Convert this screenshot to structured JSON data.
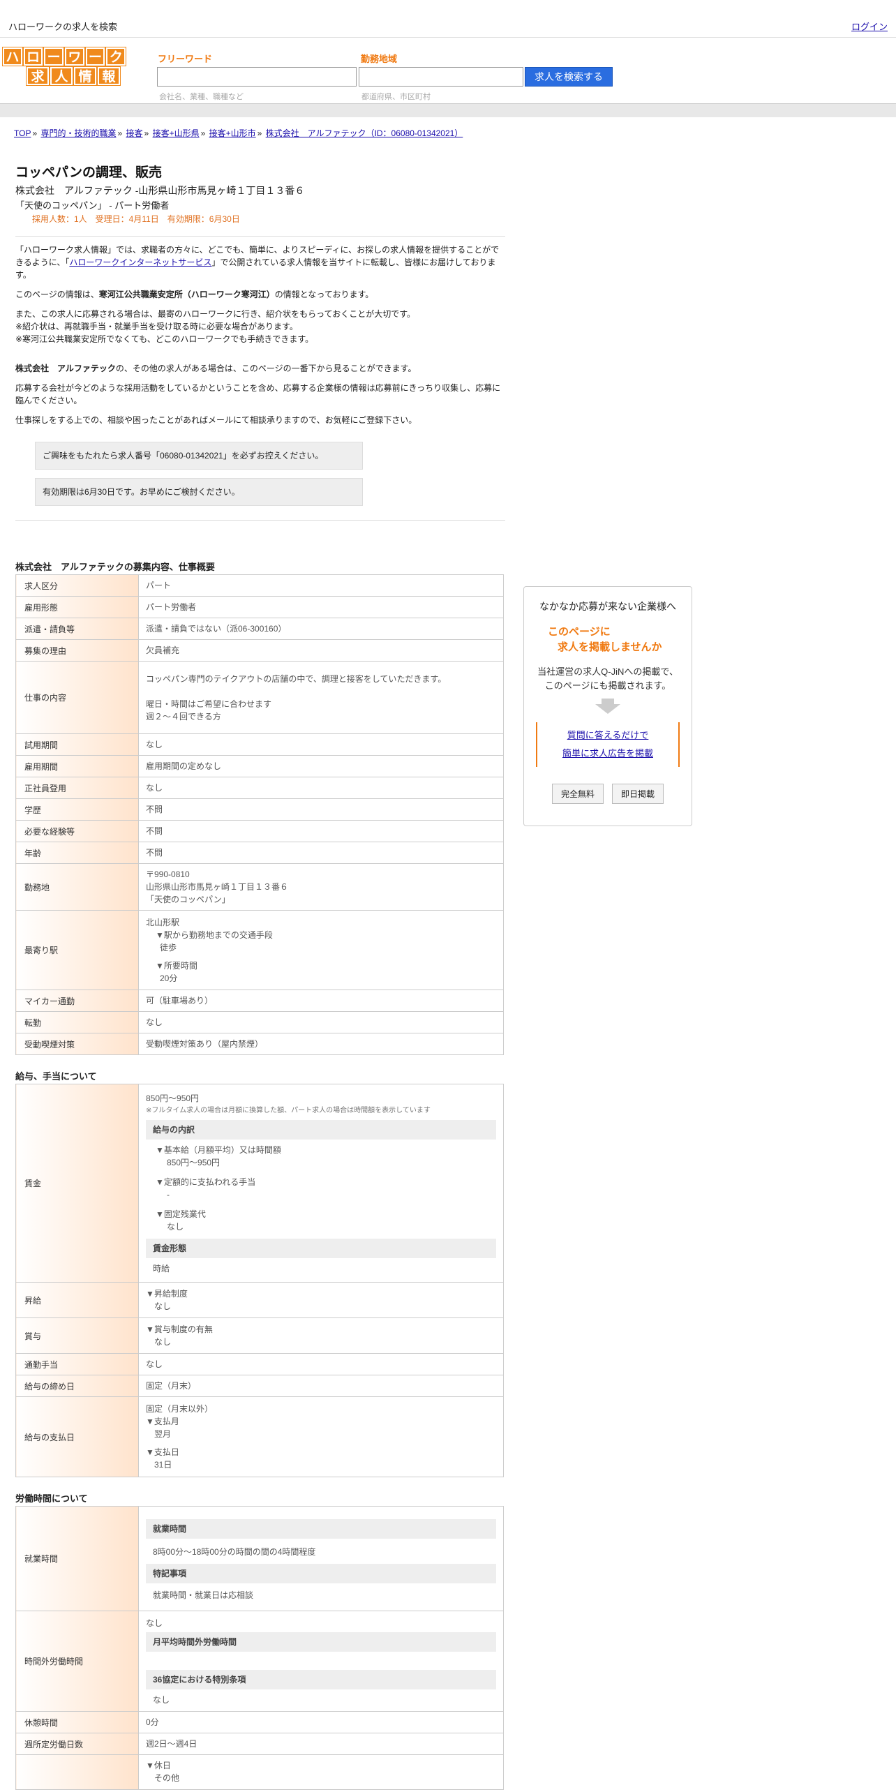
{
  "topbar": {
    "site_title": "ハローワークの求人を検索",
    "login": "ログイン"
  },
  "logo": {
    "row1": [
      "ハ",
      "ロ",
      "ー",
      "ワ",
      "ー",
      "ク"
    ],
    "row2": [
      "求",
      "人",
      "情",
      "報"
    ]
  },
  "search": {
    "keyword_label": "フリーワード",
    "keyword_placeholder": "会社名、業種、職種など",
    "area_label": "勤務地域",
    "area_placeholder": "都道府県、市区町村",
    "button": "求人を検索する"
  },
  "breadcrumb": [
    "TOP",
    "専門的・技術的職業",
    "接客",
    "接客+山形県",
    "接客+山形市",
    "株式会社　アルファテック（ID：06080-01342021）"
  ],
  "job": {
    "title": "コッペパンの調理、販売",
    "company_line": "株式会社　アルファテック -山形県山形市馬見ヶ崎１丁目１３番６",
    "sub_line": "「天使のコッペパン」 - パート労働者",
    "meta": "採用人数：1人　受理日：4月11日　有効期限：6月30日"
  },
  "intro": {
    "p1a": "「ハローワーク求人情報」では、求職者の方々に、どこでも、簡単に、よりスピーディに、お探しの求人情報を提供することができるように、「",
    "p1link": "ハローワークインターネットサービス",
    "p1b": "」で公開されている求人情報を当サイトに転載し、皆様にお届けしております。",
    "p2a": "このページの情報は、",
    "p2b": "寒河江公共職業安定所（ハローワーク寒河江）",
    "p2c": "の情報となっております。",
    "p3": "また、この求人に応募される場合は、最寄のハローワークに行き、紹介状をもらっておくことが大切です。",
    "p3b": "※紹介状は、再就職手当・就業手当を受け取る時に必要な場合があります。",
    "p3c": "※寒河江公共職業安定所でなくても、どこのハローワークでも手続きできます。",
    "p4a": "株式会社　アルファテック",
    "p4b": "の、その他の求人がある場合は、このページの一番下から見ることができます。",
    "p5": "応募する会社が今どのような採用活動をしているかということを含め、応募する企業様の情報は応募前にきっちり収集し、応募に臨んでください。",
    "p6": "仕事探しをする上での、相談や困ったことがあればメールにて相談承りますので、お気軽にご登録下さい。",
    "notice1": "ご興味をもたれたら求人番号「06080-01342021」を必ずお控えください。",
    "notice2": "有効期限は6月30日です。お早めにご検討ください。"
  },
  "overview": {
    "title": "株式会社　アルファテックの募集内容、仕事概要",
    "rows": {
      "kubun": [
        "求人区分",
        "パート"
      ],
      "keitai": [
        "雇用形態",
        "パート労働者"
      ],
      "haken": [
        "派遣・請負等",
        "派遣・請負ではない（派06-300160）"
      ],
      "riyu": [
        "募集の理由",
        "欠員補充"
      ],
      "naiyo_h": "仕事の内容",
      "naiyo_1": "コッペパン専門のテイクアウトの店舗の中で、調理と接客をしていただきます。",
      "naiyo_2": "曜日・時間はご希望に合わせます",
      "naiyo_3": "週２～４回できる方",
      "shiyo": [
        "試用期間",
        "なし"
      ],
      "koyo": [
        "雇用期間",
        "雇用期間の定めなし"
      ],
      "seishain": [
        "正社員登用",
        "なし"
      ],
      "gakureki": [
        "学歴",
        "不問"
      ],
      "keiken": [
        "必要な経験等",
        "不問"
      ],
      "nenrei": [
        "年齢",
        "不問"
      ],
      "kinmuchi_h": "勤務地",
      "kinmuchi_1": "〒990-0810",
      "kinmuchi_2": "山形県山形市馬見ヶ崎１丁目１３番６",
      "kinmuchi_3": "「天使のコッペパン」",
      "eki_h": "最寄り駅",
      "eki_1": "北山形駅",
      "eki_2": "▼駅から勤務地までの交通手段",
      "eki_3": "徒歩",
      "eki_4": "▼所要時間",
      "eki_5": "20分",
      "mycar": [
        "マイカー通勤",
        "可（駐車場あり）"
      ],
      "tenkin": [
        "転勤",
        "なし"
      ],
      "kitsuen": [
        "受動喫煙対策",
        "受動喫煙対策あり（屋内禁煙）"
      ]
    }
  },
  "pay": {
    "title": "給与、手当について",
    "chingin_h": "賃金",
    "chingin_1": "850円〜950円",
    "chingin_note": "※フルタイム求人の場合は月額に換算した額、パート求人の場合は時間額を表示しています",
    "uchiwake": "給与の内訳",
    "kihon_h": "▼基本給（月額平均）又は時間額",
    "kihon_v": "850円〜950円",
    "teigaku_h": "▼定額的に支払われる手当",
    "teigaku_v": "-",
    "kotei_h": "▼固定残業代",
    "kotei_v": "なし",
    "keitai_h": "賃金形態",
    "keitai_v": "時給",
    "shokyu_h": "昇給",
    "shokyu_1": "▼昇給制度",
    "shokyu_2": "なし",
    "shoyo_h": "賞与",
    "shoyo_1": "▼賞与制度の有無",
    "shoyo_2": "なし",
    "tsukin": [
      "通勤手当",
      "なし"
    ],
    "shime": [
      "給与の締め日",
      "固定（月末）"
    ],
    "shiharai_h": "給与の支払日",
    "shiharai_1": "固定（月末以外）",
    "shiharai_2": "▼支払月",
    "shiharai_3": "翌月",
    "shiharai_4": "▼支払日",
    "shiharai_5": "31日"
  },
  "hours": {
    "title": "労働時間について",
    "shugyo_h": "就業時間",
    "shugyo_sub": "就業時間",
    "shugyo_v": "8時00分〜18時00分の時間の間の4時間程度",
    "tokki_sub": "特記事項",
    "tokki_v": "就業時間・就業日は応相談",
    "jikangai_h": "時間外労働時間",
    "jikangai_v": "なし",
    "tsuki_sub": "月平均時間外労働時間",
    "kyotei_sub": "36協定における特別条項",
    "kyotei_v": "なし",
    "kyukei": [
      "休憩時間",
      "0分"
    ],
    "shotei": [
      "週所定労働日数",
      "週2日〜週4日"
    ],
    "kyujitsu_1": "▼休日",
    "kyujitsu_2": "その他"
  },
  "ad": {
    "t1": "なかなか応募が来ない企業様へ",
    "t2a": "このページに",
    "t2b": "求人を掲載しませんか",
    "t3a": "当社運営の求人Q-JiNへの掲載で、",
    "t3b": "このページにも掲載されます。",
    "link1": "質問に答えるだけで",
    "link2": "簡単に求人広告を掲載",
    "btn1": "完全無料",
    "btn2": "即日掲載"
  }
}
